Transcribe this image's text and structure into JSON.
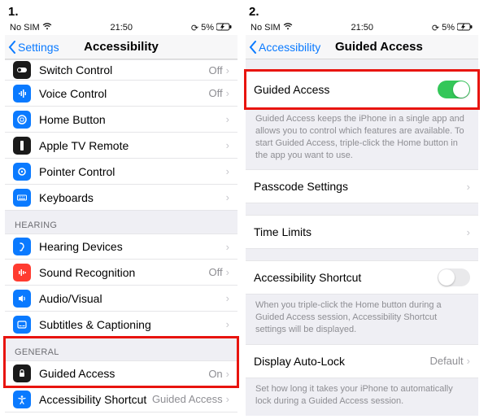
{
  "steps": {
    "s1": "1.",
    "s2": "2."
  },
  "status": {
    "carrier": "No SIM",
    "time": "21:50",
    "battery": "5%"
  },
  "chevron_glyph": "›",
  "recent_glyph": "⟳",
  "left": {
    "back": "Settings",
    "title": "Accessibility",
    "items": [
      {
        "icon": "switch-control-icon",
        "bg": "#1a1a1a",
        "label": "Switch Control",
        "value": "Off"
      },
      {
        "icon": "voice-control-icon",
        "bg": "#0a7aff",
        "label": "Voice Control",
        "value": "Off"
      },
      {
        "icon": "home-button-icon",
        "bg": "#0a7aff",
        "label": "Home Button",
        "value": ""
      },
      {
        "icon": "appletv-remote-icon",
        "bg": "#1a1a1a",
        "label": "Apple TV Remote",
        "value": ""
      },
      {
        "icon": "pointer-control-icon",
        "bg": "#0a7aff",
        "label": "Pointer Control",
        "value": ""
      },
      {
        "icon": "keyboards-icon",
        "bg": "#0a7aff",
        "label": "Keyboards",
        "value": ""
      }
    ],
    "hearing_header": "HEARING",
    "hearing": [
      {
        "icon": "hearing-devices-icon",
        "bg": "#0a7aff",
        "label": "Hearing Devices",
        "value": ""
      },
      {
        "icon": "sound-recognition-icon",
        "bg": "#ff3b30",
        "label": "Sound Recognition",
        "value": "Off"
      },
      {
        "icon": "audio-visual-icon",
        "bg": "#0a7aff",
        "label": "Audio/Visual",
        "value": ""
      },
      {
        "icon": "subtitles-icon",
        "bg": "#0a7aff",
        "label": "Subtitles & Captioning",
        "value": ""
      }
    ],
    "general_header": "GENERAL",
    "general": [
      {
        "icon": "guided-access-icon",
        "bg": "#1a1a1a",
        "label": "Guided Access",
        "value": "On"
      },
      {
        "icon": "accessibility-shortcut-icon",
        "bg": "#0a7aff",
        "label": "Accessibility Shortcut",
        "value": "Guided Access"
      }
    ]
  },
  "right": {
    "back": "Accessibility",
    "title": "Guided Access",
    "rows": {
      "ga_label": "Guided Access",
      "ga_on": true,
      "ga_footer": "Guided Access keeps the iPhone in a single app and allows you to control which features are available. To start Guided Access, triple-click the Home button in the app you want to use.",
      "passcode": "Passcode Settings",
      "timelimits": "Time Limits",
      "shortcut": "Accessibility Shortcut",
      "shortcut_on": false,
      "shortcut_footer": "When you triple-click the Home button during a Guided Access session, Accessibility Shortcut settings will be displayed.",
      "autolock": "Display Auto-Lock",
      "autolock_value": "Default",
      "autolock_footer": "Set how long it takes your iPhone to automatically lock during a Guided Access session."
    }
  }
}
